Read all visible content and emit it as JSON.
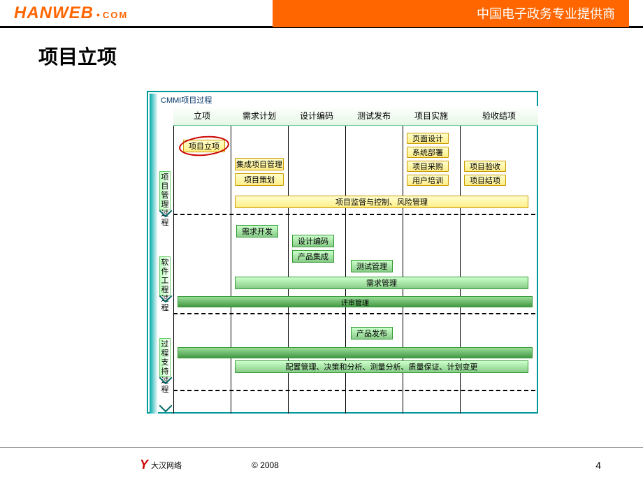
{
  "header": {
    "logo": "HANWEB",
    "dot": "•",
    "com": "COM",
    "tagline": "中国电子政务专业提供商"
  },
  "slide_title": "项目立项",
  "diagram": {
    "title": "CMMI项目过程",
    "columns": [
      "立项",
      "需求计划",
      "设计编码",
      "测试发布",
      "项目实施",
      "验收结项"
    ],
    "rows": [
      "项目管理过程",
      "软件工程过程",
      "过程支持过程"
    ],
    "row1": {
      "highlight": "项目立项",
      "b1": "集成项目管理",
      "b2": "项目策划",
      "impl": [
        "页面设计",
        "系统部署",
        "项目采购",
        "用户培训"
      ],
      "accept": [
        "项目验收",
        "项目结项"
      ],
      "span": "项目监督与控制、风险管理"
    },
    "row2": {
      "b1": "需求开发",
      "b2": "设计编码",
      "b3": "产品集成",
      "b4": "测试管理",
      "span1": "需求管理",
      "span2": "评审管理"
    },
    "row3": {
      "b1": "产品发布",
      "span": "配置管理、决策和分析、测量分析、质量保证、计划变更"
    }
  },
  "footer": {
    "logo_text": "大汉网络",
    "copyright": "© 2008",
    "page": "4"
  }
}
